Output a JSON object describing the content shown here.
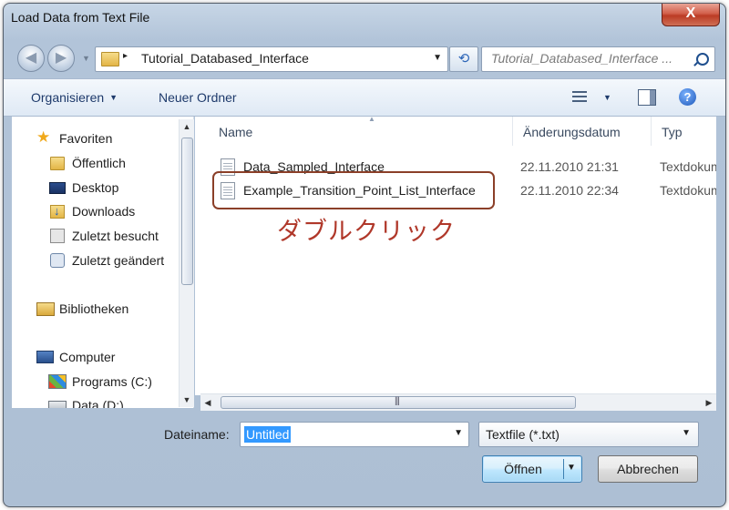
{
  "window": {
    "title": "Load Data from Text File",
    "close_glyph": "X"
  },
  "address": {
    "path_separator": "▸",
    "current_folder": "Tutorial_Databased_Interface",
    "search_placeholder": "Tutorial_Databased_Interface ..."
  },
  "toolbar": {
    "organize": "Organisieren",
    "new_folder": "Neuer Ordner"
  },
  "nav": {
    "items": [
      {
        "label": "Favoriten",
        "icon": "star-icon"
      },
      {
        "label": "Öffentlich",
        "icon": "folder-icon"
      },
      {
        "label": "Desktop",
        "icon": "desktop-icon"
      },
      {
        "label": "Downloads",
        "icon": "downloads-icon"
      },
      {
        "label": "Zuletzt besucht",
        "icon": "recent-places-icon"
      },
      {
        "label": "Zuletzt geändert",
        "icon": "recently-changed-icon"
      },
      {
        "label": "Bibliotheken",
        "icon": "libraries-icon"
      },
      {
        "label": "Computer",
        "icon": "computer-icon"
      },
      {
        "label": "Programs (C:)",
        "icon": "windows-drive-icon"
      },
      {
        "label": "Data (D:)",
        "icon": "drive-icon"
      }
    ]
  },
  "files": {
    "columns": {
      "name": "Name",
      "date": "Änderungsdatum",
      "type": "Typ"
    },
    "rows": [
      {
        "name": "Data_Sampled_Interface",
        "date": "22.11.2010 21:31",
        "type": "Textdokument"
      },
      {
        "name": "Example_Transition_Point_List_Interface",
        "date": "22.11.2010 22:34",
        "type": "Textdokument"
      }
    ]
  },
  "annotation": {
    "text": "ダブルクリック",
    "color": "#b0382a"
  },
  "footer": {
    "filename_label": "Dateiname:",
    "filename_value": "Untitled",
    "filetype": "Textfile (*.txt)",
    "open_label": "Öffnen",
    "cancel_label": "Abbrechen"
  }
}
